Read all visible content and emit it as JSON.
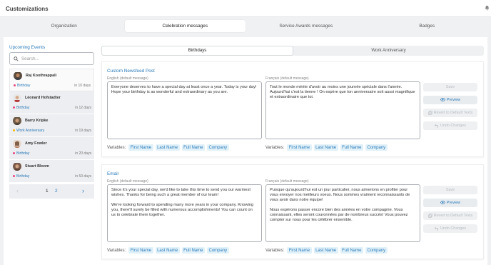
{
  "app": {
    "title": "Customizations",
    "bell_icon": "bell-icon"
  },
  "main_tabs": [
    {
      "label": "Organization",
      "active": false
    },
    {
      "label": "Celebration messages",
      "active": true
    },
    {
      "label": "Service Awards messages",
      "active": false
    },
    {
      "label": "Badges",
      "active": false
    }
  ],
  "events": {
    "title": "Upcoming Events",
    "search_placeholder": "Search...",
    "items": [
      {
        "name": "Raj Koothrappali",
        "type": "Birthday",
        "when": "in 10 days",
        "dot_color": "#e64980"
      },
      {
        "name": "Léonard Hofstadter",
        "type": "Birthday",
        "when": "in 12 days",
        "dot_color": "#e64980"
      },
      {
        "name": "Barry Kripke",
        "type": "Work Anniversary",
        "when": "in 19 days",
        "dot_color": "#f4b400"
      },
      {
        "name": "Amy Fowler",
        "type": "Birthday",
        "when": "in 20 days",
        "dot_color": "#e64980"
      },
      {
        "name": "Stuart Bloom",
        "type": "Birthday",
        "when": "in 53 days",
        "dot_color": "#e64980"
      }
    ],
    "pager": {
      "prev": "‹",
      "page1": "1",
      "page2": "2",
      "next": "›"
    }
  },
  "sub_tabs": [
    {
      "label": "Birthdays",
      "active": true
    },
    {
      "label": "Work Anniversary",
      "active": false
    }
  ],
  "cards": {
    "newsfeed": {
      "title": "Custom Newsfeed Post",
      "en_label": "English (default message)",
      "fr_label": "Français (default message)",
      "en_text": "Everyone deserves to have a special day at least once a year. Today is your day! Hope your birthday is as wonderful and extraordinary as you are.",
      "fr_text": "Tout le monde mérite d'avoir au moins une journée spéciale dans l'année. Aujourd'hui c'est la tienne ! On espère que ton anniversaire soit aussi magnifique et extraordinaire que toi.",
      "variables_label": "Variables:",
      "variables": [
        "First Name",
        "Last Name",
        "Full Name",
        "Company"
      ],
      "buttons": {
        "save": "Save",
        "preview": "Preview",
        "revert": "Revert to Default Texts",
        "undo": "Undo Changes"
      }
    },
    "email": {
      "title": "Email",
      "en_label": "English (default message)",
      "fr_label": "Français (default message)",
      "en_text": "Since it's your special day, we'd like to take this time to send you our warmest wishes. Thanks for being such a great member of our team!\n\nWe're looking forward to spending many more years in your company. Knowing you, there'll surely be filled with numerous accomplishments! You can count on us to celebrate them together.",
      "fr_text": "Puisque qu'aujourd'hui est un jour particulier, nous aimerions en profiter pour vous envoyer nos meilleurs voeux. Nous sommes vraiment reconnaissants de vous avoir dans notre équipe!\n\nNous espérons passer encore bien des années en votre compagnie. Vous connaissant, elles seront couronnées par de nombreux succès! Vous pouvez compter sur nous pour les célébrer ensemble.",
      "variables_label": "Variables:",
      "variables": [
        "First Name",
        "Last Name",
        "Full Name",
        "Company"
      ],
      "buttons": {
        "save": "Save",
        "preview": "Preview",
        "revert": "Revert to Default Texts",
        "undo": "Undo Changes"
      }
    }
  },
  "colors": {
    "accent": "#2a7ab8",
    "chip_bg": "#e1f1f9",
    "birthday": "#e64980",
    "anniversary": "#f4b400"
  }
}
